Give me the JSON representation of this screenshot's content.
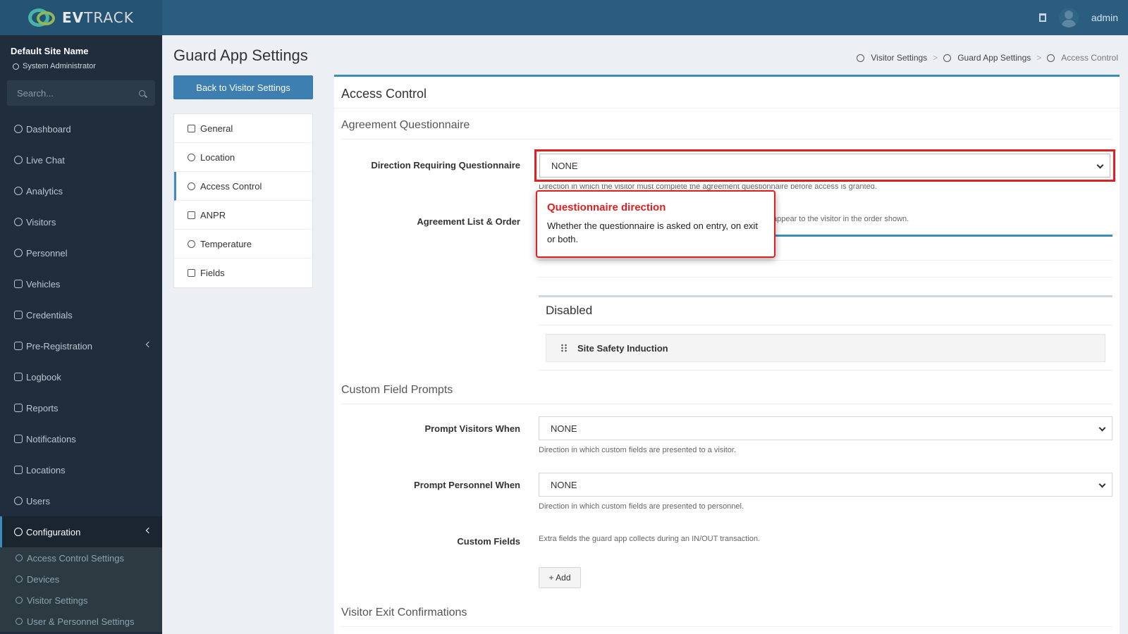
{
  "header": {
    "logo_text_bold": "EV",
    "logo_text_light": "TRACK",
    "user_name": "admin"
  },
  "sidebar": {
    "site_name": "Default Site Name",
    "role": "System Administrator",
    "search_placeholder": "Search...",
    "items": [
      {
        "label": "Dashboard",
        "icon": "dashboard-icon"
      },
      {
        "label": "Live Chat",
        "icon": "headset-icon"
      },
      {
        "label": "Analytics",
        "icon": "analytics-icon"
      },
      {
        "label": "Visitors",
        "icon": "eye-icon"
      },
      {
        "label": "Personnel",
        "icon": "user-icon"
      },
      {
        "label": "Vehicles",
        "icon": "car-icon"
      },
      {
        "label": "Credentials",
        "icon": "id-card-icon"
      },
      {
        "label": "Pre-Registration",
        "icon": "arrows-icon"
      },
      {
        "label": "Logbook",
        "icon": "book-icon"
      },
      {
        "label": "Reports",
        "icon": "chart-icon"
      },
      {
        "label": "Notifications",
        "icon": "chat-icon"
      },
      {
        "label": "Locations",
        "icon": "map-icon"
      },
      {
        "label": "Users",
        "icon": "users-icon"
      },
      {
        "label": "Configuration",
        "icon": "gear-icon"
      }
    ],
    "sub_items": [
      {
        "label": "Access Control Settings"
      },
      {
        "label": "Devices"
      },
      {
        "label": "Visitor Settings"
      },
      {
        "label": "User & Personnel Settings"
      }
    ]
  },
  "page": {
    "title": "Guard App Settings",
    "back_button": "Back to Visitor Settings",
    "breadcrumb": [
      "Visitor Settings",
      "Guard App Settings",
      "Access Control"
    ],
    "menu": [
      {
        "label": "General"
      },
      {
        "label": "Location"
      },
      {
        "label": "Access Control"
      },
      {
        "label": "ANPR"
      },
      {
        "label": "Temperature"
      },
      {
        "label": "Fields"
      }
    ]
  },
  "panel": {
    "title": "Access Control",
    "agreement_section": "Agreement Questionnaire",
    "direction_label": "Direction Requiring Questionnaire",
    "direction_value": "NONE",
    "direction_help": "Direction in which the visitor must complete the agreement questionnaire before access is granted.",
    "agreement_list_label": "Agreement List & Order",
    "agreement_list_help": "appear to the visitor in the order shown.",
    "disabled_title": "Disabled",
    "disabled_item": "Site Safety Induction",
    "custom_section": "Custom Field Prompts",
    "prompt_visitors_label": "Prompt Visitors When",
    "prompt_visitors_value": "NONE",
    "prompt_visitors_help": "Direction in which custom fields are presented to a visitor.",
    "prompt_personnel_label": "Prompt Personnel When",
    "prompt_personnel_value": "NONE",
    "prompt_personnel_help": "Direction in which custom fields are presented to personnel.",
    "custom_fields_label": "Custom Fields",
    "custom_fields_help": "Extra fields the guard app collects during an IN/OUT transaction.",
    "add_button": "+ Add",
    "exit_section": "Visitor Exit Confirmations"
  },
  "tooltip": {
    "title": "Questionnaire direction",
    "body": "Whether the questionnaire is asked on entry, on exit or both."
  },
  "colors": {
    "header": "#2a5d80",
    "sidebar": "#1f2d3d",
    "accent": "#3c8dbc",
    "highlight": "#e02020"
  }
}
